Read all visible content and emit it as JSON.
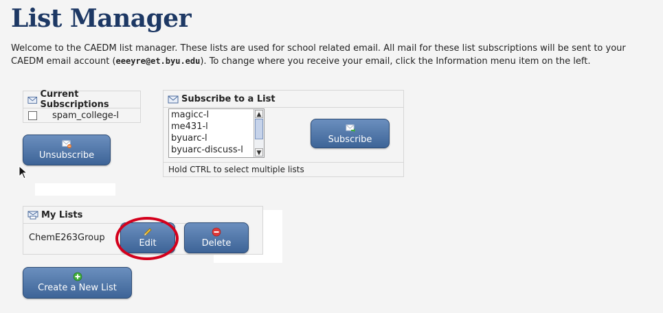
{
  "page": {
    "title": "List Manager",
    "intro_before": "Welcome to the CAEDM list manager. These lists are used for school related email. All mail for these list subscriptions will be sent to your CAEDM email account (",
    "intro_email": "eeeyre@et.byu.edu",
    "intro_after": "). To change where you receive your email, click the Information menu item on the left."
  },
  "current_subscriptions": {
    "heading": "Current Subscriptions",
    "icon": "envelope-icon",
    "items": [
      {
        "label": "spam_college-l",
        "checked": false
      }
    ],
    "unsubscribe_label": "Unsubscribe"
  },
  "subscribe": {
    "heading": "Subscribe to a List",
    "icon": "envelope-icon",
    "options": [
      "magicc-l",
      "me431-l",
      "byuarc-l",
      "byuarc-discuss-l"
    ],
    "button_label": "Subscribe",
    "hint": "Hold CTRL to select multiple lists"
  },
  "my_lists": {
    "heading": "My Lists",
    "icon": "envelope-print-icon",
    "items": [
      {
        "name": "ChemE263Group"
      }
    ],
    "edit_label": "Edit",
    "delete_label": "Delete"
  },
  "create_label": "Create a New List",
  "colors": {
    "title": "#1d3864",
    "button_top": "#6b8fbe",
    "button_bottom": "#3d6497",
    "highlight_ring": "#d4001c"
  }
}
